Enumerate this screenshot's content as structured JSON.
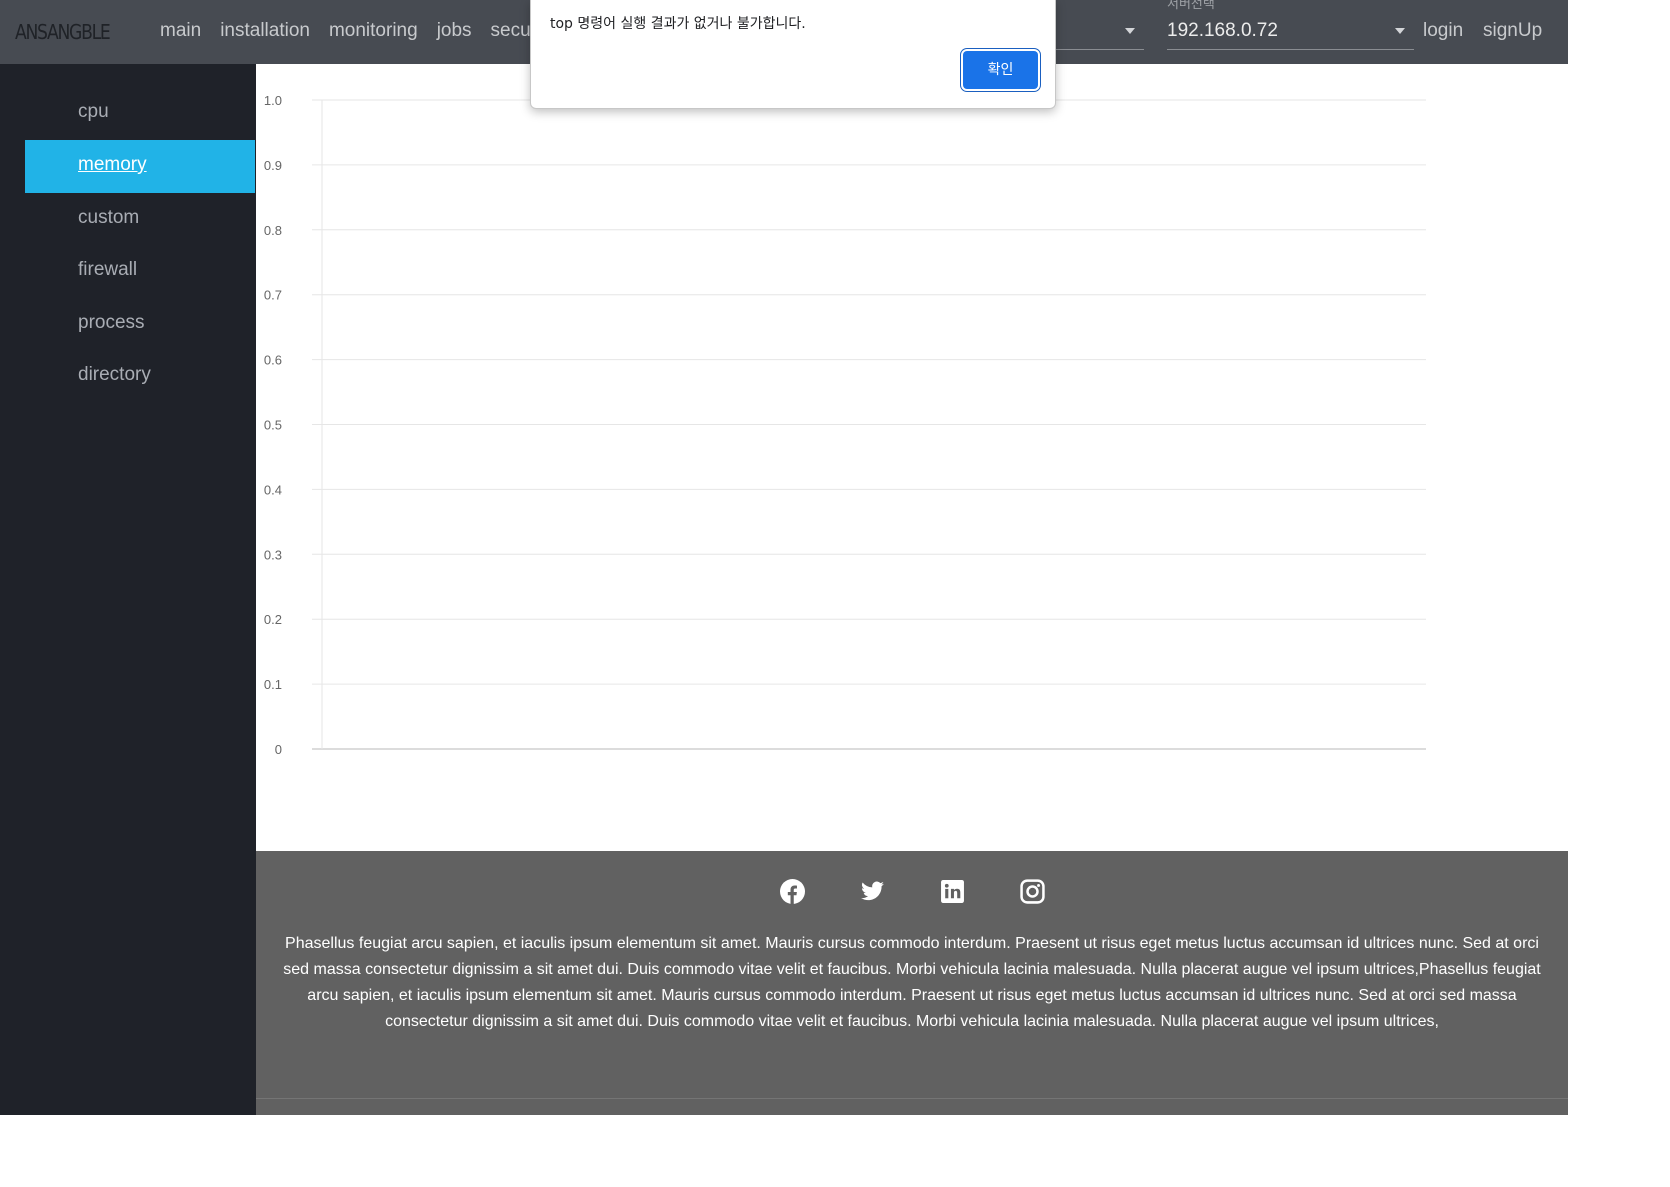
{
  "app": {
    "logo": "ANSANGBLE"
  },
  "nav": {
    "items": [
      "main",
      "installation",
      "monitoring",
      "jobs",
      "secu"
    ]
  },
  "server_select": {
    "label": "서버선택",
    "value": "192.168.0.72"
  },
  "auth": {
    "login": "login",
    "signup": "signUp"
  },
  "sidebar": {
    "items": [
      "cpu",
      "memory",
      "custom",
      "firewall",
      "process",
      "directory"
    ],
    "active": "memory"
  },
  "chart_data": {
    "type": "line",
    "title": "",
    "xlabel": "",
    "ylabel": "",
    "ylim": [
      0,
      1.0
    ],
    "yticks": [
      "0",
      "0.1",
      "0.2",
      "0.3",
      "0.4",
      "0.5",
      "0.6",
      "0.7",
      "0.8",
      "0.9",
      "1.0"
    ],
    "series": [],
    "grid": true
  },
  "footer": {
    "social": [
      "facebook-icon",
      "twitter-icon",
      "linkedin-icon",
      "instagram-icon"
    ],
    "text": "Phasellus feugiat arcu sapien, et iaculis ipsum elementum sit amet. Mauris cursus commodo interdum. Praesent ut risus eget metus luctus accumsan id ultrices nunc. Sed at orci sed massa consectetur dignissim a sit amet dui. Duis commodo vitae velit et faucibus. Morbi vehicula lacinia malesuada. Nulla placerat augue vel ipsum ultrices,Phasellus feugiat arcu sapien, et iaculis ipsum elementum sit amet. Mauris cursus commodo interdum. Praesent ut risus eget metus luctus accumsan id ultrices nunc. Sed at orci sed massa consectetur dignissim a sit amet dui. Duis commodo vitae velit et faucibus. Morbi vehicula lacinia malesuada. Nulla placerat augue vel ipsum ultrices,"
  },
  "dialog": {
    "message": "top 명령어 실행 결과가 없거나 불가합니다.",
    "confirm_label": "확인",
    "button_color": "#1a73e8"
  },
  "colors": {
    "topbar": "#474b52",
    "sidebar": "#1f2229",
    "accent": "#21b3e7",
    "footer": "#616161"
  }
}
